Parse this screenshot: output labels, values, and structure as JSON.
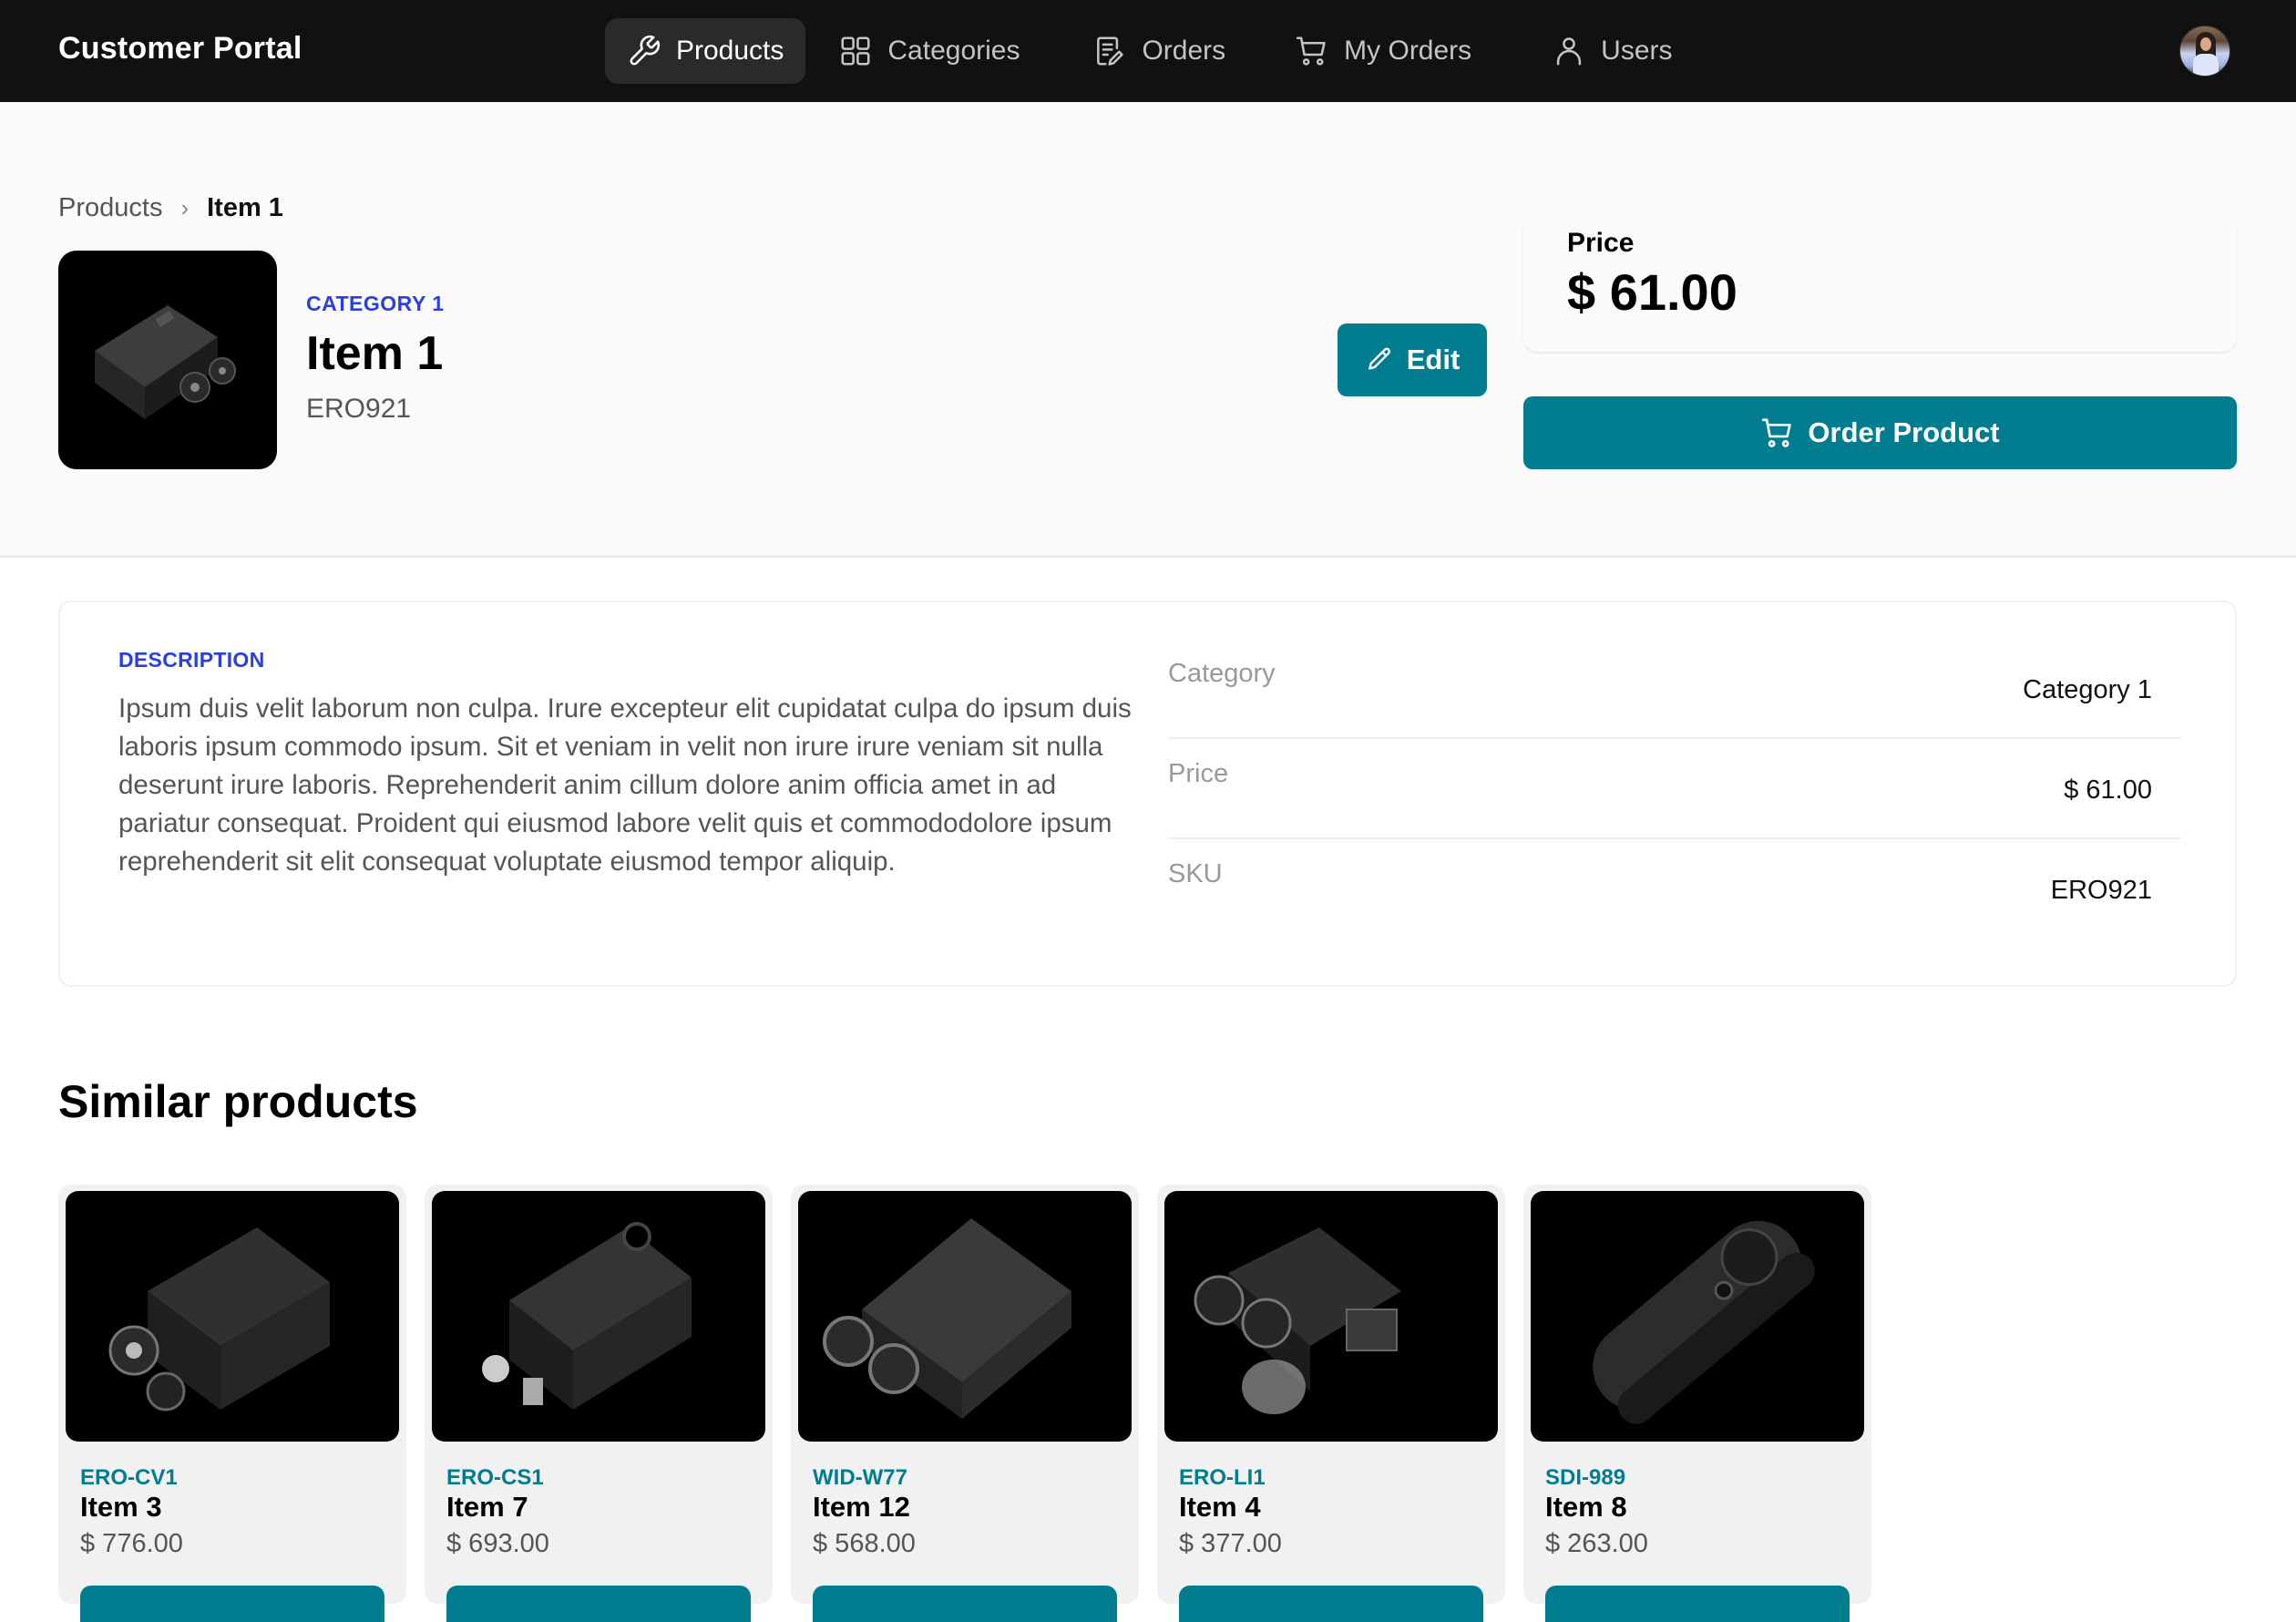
{
  "nav": {
    "brand": "Customer Portal",
    "items": [
      {
        "label": "Products",
        "icon": "wrench-icon",
        "active": true
      },
      {
        "label": "Categories",
        "icon": "grid-icon",
        "active": false
      },
      {
        "label": "Orders",
        "icon": "document-edit-icon",
        "active": false
      },
      {
        "label": "My Orders",
        "icon": "cart-icon",
        "active": false
      },
      {
        "label": "Users",
        "icon": "user-icon",
        "active": false
      }
    ],
    "avatar_alt": "User avatar"
  },
  "breadcrumb": {
    "parent": "Products",
    "separator": "›",
    "current": "Item 1"
  },
  "product": {
    "category": "CATEGORY 1",
    "name": "Item 1",
    "sku": "ERO921",
    "price_label": "Price",
    "price": "$ 61.00",
    "edit_label": "Edit",
    "order_label": "Order Product"
  },
  "description": {
    "label": "DESCRIPTION",
    "text": "Ipsum duis velit laborum non culpa. Irure excepteur elit cupidatat culpa do ipsum duis laboris ipsum commodo ipsum. Sit et veniam in velit non irure irure veniam sit nulla deserunt irure laboris. Reprehenderit anim cillum dolore anim officia amet in ad pariatur consequat. Proident qui eiusmod labore velit quis et commododolore ipsum reprehenderit sit elit consequat voluptate eiusmod tempor aliquip."
  },
  "specs": [
    {
      "key": "Category",
      "value": "Category 1"
    },
    {
      "key": "Price",
      "value": "$ 61.00"
    },
    {
      "key": "SKU",
      "value": "ERO921"
    }
  ],
  "similar": {
    "title": "Similar products",
    "items": [
      {
        "sku": "ERO-CV1",
        "name": "Item 3",
        "price": "$ 776.00"
      },
      {
        "sku": "ERO-CS1",
        "name": "Item 7",
        "price": "$ 693.00"
      },
      {
        "sku": "WID-W77",
        "name": "Item 12",
        "price": "$ 568.00"
      },
      {
        "sku": "ERO-LI1",
        "name": "Item 4",
        "price": "$ 377.00"
      },
      {
        "sku": "SDI-989",
        "name": "Item 8",
        "price": "$ 263.00"
      }
    ]
  },
  "colors": {
    "nav_bg": "#111111",
    "accent_teal": "#017d8f",
    "accent_blue": "#2b3fe0",
    "hero_bg": "#fafafa",
    "card_bg": "#f1f1f1"
  }
}
